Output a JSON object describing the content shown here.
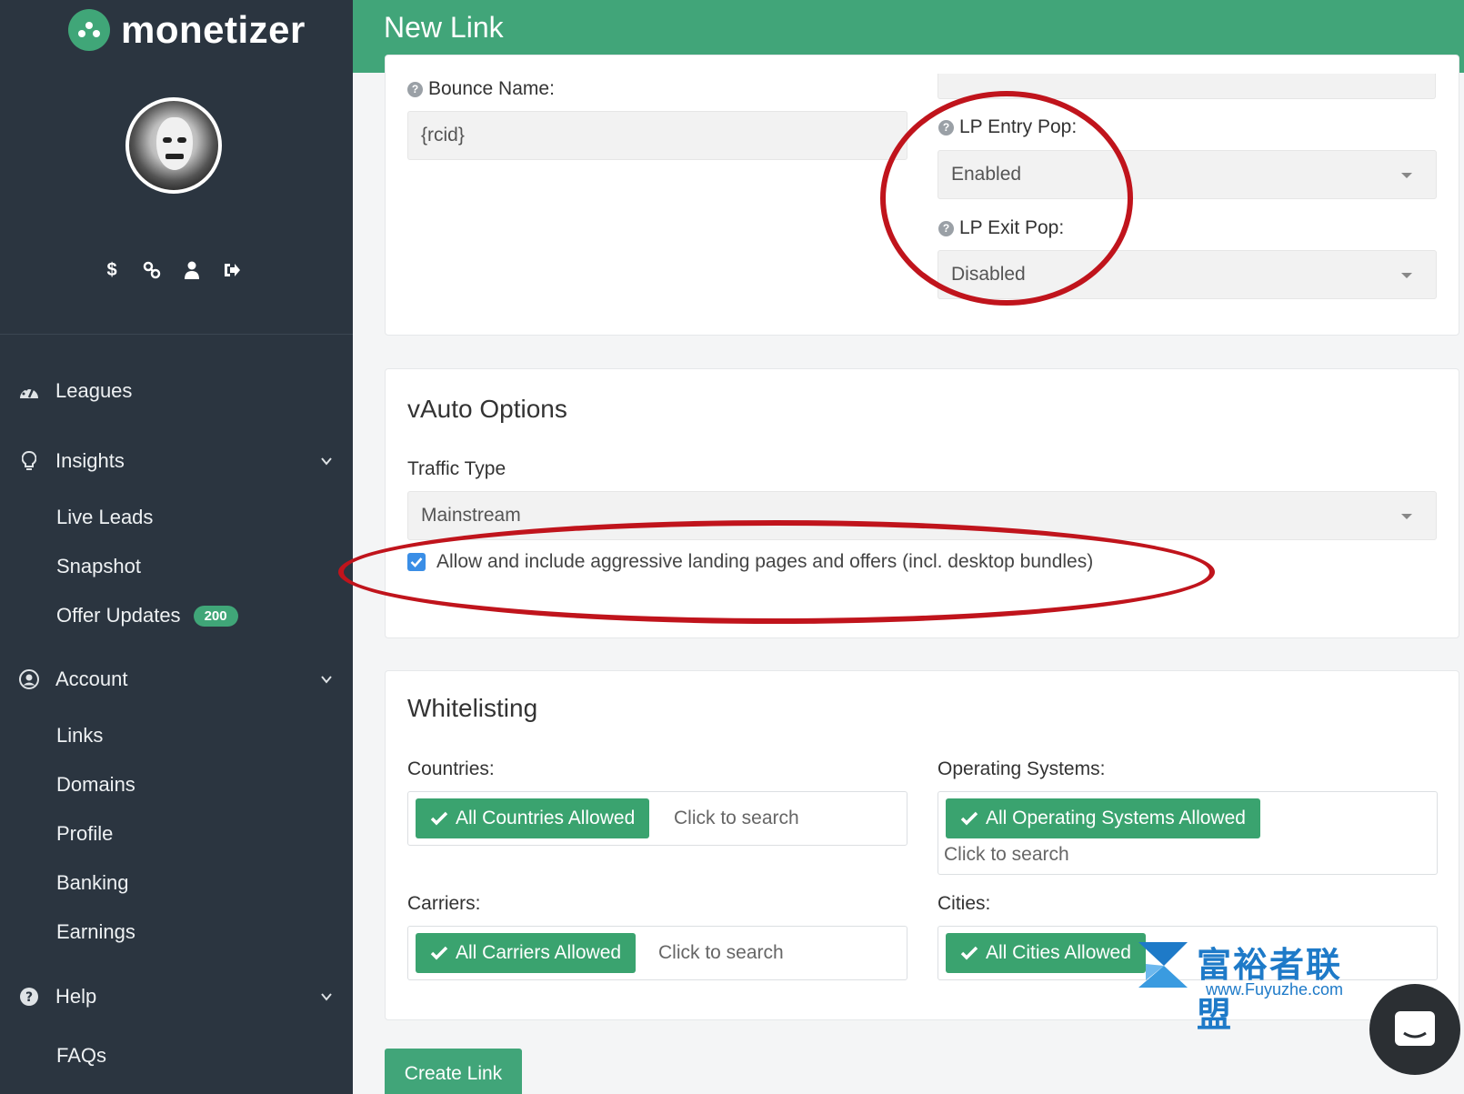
{
  "brand": {
    "name": "monetizer"
  },
  "header": {
    "title": "New Link"
  },
  "sidebar": {
    "quick_icons": [
      "dollar-icon",
      "link-icon",
      "user-icon",
      "sign-out-icon"
    ],
    "nav": [
      {
        "label": "Leagues",
        "icon": "dashboard-icon"
      },
      {
        "label": "Insights",
        "icon": "lightbulb-icon"
      },
      {
        "label": "Account",
        "icon": "user-circle-icon"
      },
      {
        "label": "Help",
        "icon": "question-circle-icon"
      }
    ],
    "insights_sub": [
      "Live Leads",
      "Snapshot",
      "Offer Updates"
    ],
    "offer_updates_badge": "200",
    "account_sub": [
      "Links",
      "Domains",
      "Profile",
      "Banking",
      "Earnings"
    ],
    "help_sub": [
      "FAQs"
    ]
  },
  "form": {
    "bounce_name_label": "Bounce Name:",
    "bounce_name_value": "{rcid}",
    "lp_entry_pop_label": "LP Entry Pop:",
    "lp_entry_pop_value": "Enabled",
    "lp_exit_pop_label": "LP Exit Pop:",
    "lp_exit_pop_value": "Disabled"
  },
  "vauto": {
    "title": "vAuto Options",
    "traffic_type_label": "Traffic Type",
    "traffic_type_value": "Mainstream",
    "aggressive_checkbox_label": "Allow and include aggressive landing pages and offers (incl. desktop bundles)",
    "aggressive_checked": true
  },
  "whitelisting": {
    "title": "Whitelisting",
    "countries_label": "Countries:",
    "countries_tag": "All Countries Allowed",
    "os_label": "Operating Systems:",
    "os_tag": "All Operating Systems Allowed",
    "carriers_label": "Carriers:",
    "carriers_tag": "All Carriers Allowed",
    "cities_label": "Cities:",
    "cities_tag": "All Cities Allowed",
    "search_placeholder": "Click to search"
  },
  "create_button": "Create Link",
  "watermark": {
    "text": "富裕者联盟",
    "url": "www.Fuyuzhe.com"
  },
  "colors": {
    "brand_green": "#41a579",
    "sidebar_bg": "#2b3540",
    "annotation_red": "#c0141c",
    "checkbox_blue": "#3a8ee6"
  }
}
